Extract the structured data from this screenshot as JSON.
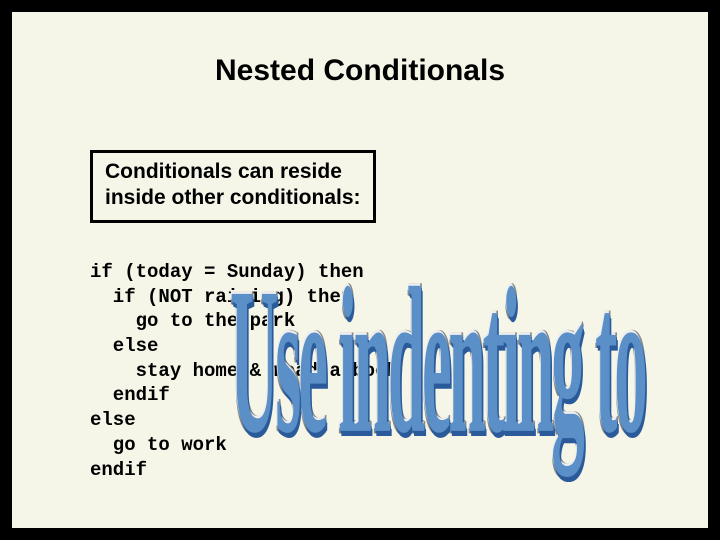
{
  "title": "Nested Conditionals",
  "statement": {
    "line1": "Conditionals can reside",
    "line2": "inside other conditionals:"
  },
  "code": "if (today = Sunday) then\n  if (NOT raining) then\n    go to the park\n  else\n    stay home & read a book\n  endif\nelse\n  go to work\nendif",
  "wordart": "Use indenting to"
}
